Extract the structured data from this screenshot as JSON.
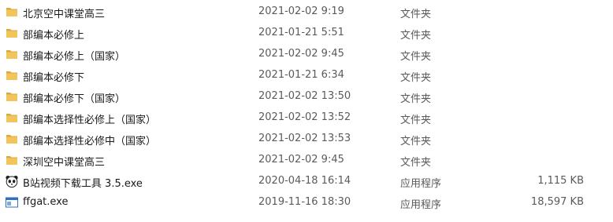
{
  "files": [
    {
      "name": "北京空中课堂高三",
      "date": "2021-02-02 9:19",
      "type": "文件夹",
      "size": "",
      "icon": "folder-icon"
    },
    {
      "name": "部编本必修上",
      "date": "2021-01-21 5:51",
      "type": "文件夹",
      "size": "",
      "icon": "folder-icon"
    },
    {
      "name": "部编本必修上（国家）",
      "date": "2021-02-02 9:45",
      "type": "文件夹",
      "size": "",
      "icon": "folder-icon"
    },
    {
      "name": "部编本必修下",
      "date": "2021-01-21 6:34",
      "type": "文件夹",
      "size": "",
      "icon": "folder-icon"
    },
    {
      "name": "部编本必修下（国家）",
      "date": "2021-02-02 13:50",
      "type": "文件夹",
      "size": "",
      "icon": "folder-icon"
    },
    {
      "name": "部编本选择性必修上（国家）",
      "date": "2021-02-02 13:52",
      "type": "文件夹",
      "size": "",
      "icon": "folder-icon"
    },
    {
      "name": "部编本选择性必修中（国家）",
      "date": "2021-02-02 13:53",
      "type": "文件夹",
      "size": "",
      "icon": "folder-icon"
    },
    {
      "name": "深圳空中课堂高三",
      "date": "2021-02-02 9:45",
      "type": "文件夹",
      "size": "",
      "icon": "folder-icon"
    },
    {
      "name": "B站视频下载工具 3.5.exe",
      "date": "2020-04-18 16:14",
      "type": "应用程序",
      "size": "1,115 KB",
      "icon": "panda-app-icon"
    },
    {
      "name": "ffgat.exe",
      "date": "2019-11-16 18:30",
      "type": "应用程序",
      "size": "18,597 KB",
      "icon": "window-app-icon"
    }
  ],
  "colors": {
    "folder_body": "#f2c55c",
    "folder_tab": "#dcaa3c",
    "app_window_blue": "#2e6fc7"
  }
}
